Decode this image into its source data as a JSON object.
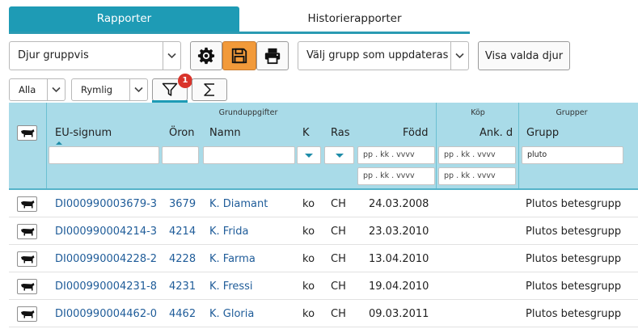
{
  "tabs": [
    {
      "label": "Rapporter",
      "active": true
    },
    {
      "label": "Historierapporter",
      "active": false
    }
  ],
  "toolbar": {
    "report_select": "Djur gruppvis",
    "group_select": "Välj grupp som uppdateras",
    "show_selected_label": "Visa valda djur",
    "icons": [
      "gear-icon",
      "save-icon",
      "print-icon"
    ]
  },
  "filters": {
    "scope_select": "Alla",
    "density_select": "Rymlig",
    "filter_count": "1",
    "icons": [
      "funnel-icon",
      "sigma-icon"
    ]
  },
  "table": {
    "groups": {
      "basic": "Grunduppgifter",
      "purchase": "Köp",
      "groups": "Grupper"
    },
    "columns": {
      "eu": "EU-signum",
      "oron": "Öron",
      "namn": "Namn",
      "k": "K",
      "ras": "Ras",
      "fodd": "Född",
      "ank": "Ank. d",
      "grupp": "Grupp"
    },
    "filter_inputs": {
      "date_placeholder": "pp . kk . vvvv",
      "grupp_value": "pluto"
    },
    "rows": [
      {
        "eu": "DI000990003679-3",
        "oron": "3679",
        "namn": "K. Diamant",
        "k": "ko",
        "ras": "CH",
        "fodd": "24.03.2008",
        "ank": "",
        "grupp": "Plutos betesgrupp"
      },
      {
        "eu": "DI000990004214-3",
        "oron": "4214",
        "namn": "K. Frida",
        "k": "ko",
        "ras": "CH",
        "fodd": "23.03.2010",
        "ank": "",
        "grupp": "Plutos betesgrupp"
      },
      {
        "eu": "DI000990004228-2",
        "oron": "4228",
        "namn": "K. Farma",
        "k": "ko",
        "ras": "CH",
        "fodd": "13.04.2010",
        "ank": "",
        "grupp": "Plutos betesgrupp"
      },
      {
        "eu": "DI000990004231-8",
        "oron": "4231",
        "namn": "K. Fressi",
        "k": "ko",
        "ras": "CH",
        "fodd": "19.04.2010",
        "ank": "",
        "grupp": "Plutos betesgrupp"
      },
      {
        "eu": "DI000990004462-0",
        "oron": "4462",
        "namn": "K. Gloria",
        "k": "ko",
        "ras": "CH",
        "fodd": "09.03.2011",
        "ank": "",
        "grupp": "Plutos betesgrupp"
      }
    ]
  },
  "colors": {
    "accent": "#1e9bb5",
    "header_bg": "#a9dbe8",
    "link": "#1f5c99",
    "save_btn": "#f29a3a"
  }
}
